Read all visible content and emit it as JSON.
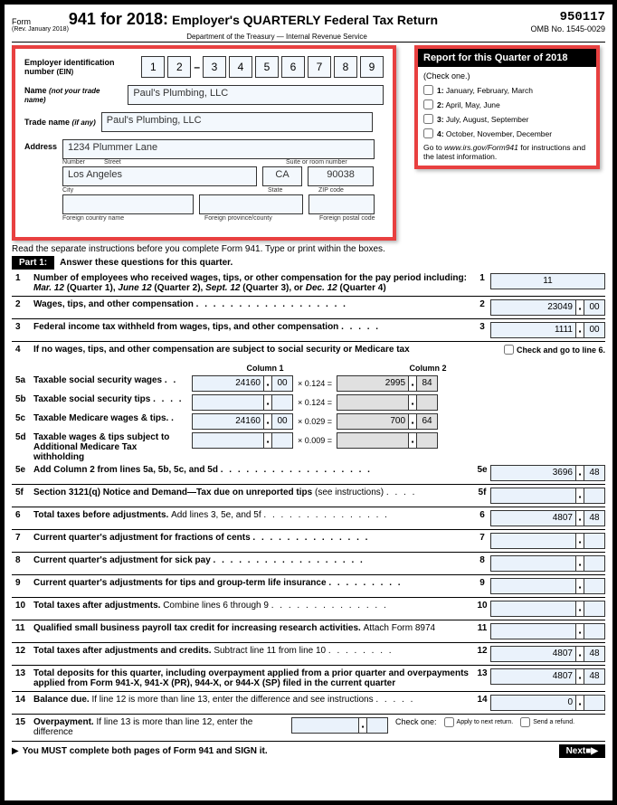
{
  "form": {
    "num_label": "Form",
    "title": "941 for 2018:",
    "subtitle": "Employer's QUARTERLY Federal Tax Return",
    "rev": "(Rev. January 2018)",
    "dept": "Department of the Treasury — Internal Revenue Service",
    "tracking": "950117",
    "omb": "OMB No. 1545-0029"
  },
  "emp": {
    "ein_label": "Employer identification number",
    "ein_paren": "(EIN)",
    "ein": [
      "1",
      "2",
      "3",
      "4",
      "5",
      "6",
      "7",
      "8",
      "9"
    ],
    "name_label": "Name",
    "name_paren": "(not your trade name)",
    "name": "Paul's Plumbing, LLC",
    "trade_label": "Trade name",
    "trade_paren": "(if any)",
    "trade": "Paul's Plumbing, LLC",
    "addr_label": "Address",
    "street": "1234 Plummer Lane",
    "number_l": "Number",
    "street_l": "Street",
    "suite_l": "Suite or room number",
    "city": "Los Angeles",
    "state": "CA",
    "zip": "90038",
    "city_l": "City",
    "state_l": "State",
    "zip_l": "ZIP code",
    "fc_l": "Foreign country name",
    "fp_l": "Foreign province/county",
    "fz_l": "Foreign postal code"
  },
  "quarter": {
    "header": "Report for this Quarter of 2018",
    "check": "(Check one.)",
    "q1": "1: January, February, March",
    "q2": "2: April, May, June",
    "q3": "3: July, August, September",
    "q4": "4: October, November, December",
    "note1": "Go to ",
    "url": "www.irs.gov/Form941",
    "note2": " for instructions and the latest information."
  },
  "instr": "Read the separate instructions before you complete Form 941. Type or print within the boxes.",
  "part1": {
    "label": "Part 1:",
    "text": "Answer these questions for this quarter."
  },
  "lines": {
    "l1": {
      "n": "1",
      "t": "Number of employees who received wages, tips, or other compensation for the pay period including: ",
      "t2": "Mar. 12",
      "t3": " (Quarter 1), ",
      "t4": "June 12",
      "t5": " (Quarter 2), ",
      "t6": "Sept. 12",
      "t7": " (Quarter 3), or ",
      "t8": "Dec. 12",
      "t9": " (Quarter 4)",
      "r": "1",
      "v": "11"
    },
    "l2": {
      "n": "2",
      "t": "Wages, tips, and other compensation",
      "r": "2",
      "v": "23049",
      "c": "00"
    },
    "l3": {
      "n": "3",
      "t": "Federal income tax withheld from wages, tips, and other compensation",
      "r": "3",
      "v": "1111",
      "c": "00"
    },
    "l4": {
      "n": "4",
      "t": "If no wages, tips, and other compensation are subject to social security or Medicare tax",
      "chk": "Check and go to line 6."
    },
    "col1": "Column 1",
    "col2": "Column 2",
    "l5a": {
      "n": "5a",
      "t": "Taxable social security wages",
      "v1": "24160",
      "c1": "00",
      "m": "× 0.124 =",
      "v2": "2995",
      "c2": "84"
    },
    "l5b": {
      "n": "5b",
      "t": "Taxable social security tips",
      "m": "× 0.124 ="
    },
    "l5c": {
      "n": "5c",
      "t": "Taxable Medicare wages & tips.",
      "v1": "24160",
      "c1": "00",
      "m": "× 0.029 =",
      "v2": "700",
      "c2": "64"
    },
    "l5d": {
      "n": "5d",
      "t": "Taxable wages & tips subject to Additional Medicare Tax withholding",
      "m": "× 0.009 ="
    },
    "l5e": {
      "n": "5e",
      "t": "Add Column 2 from lines 5a, 5b, 5c, and 5d",
      "r": "5e",
      "v": "3696",
      "c": "48"
    },
    "l5f": {
      "n": "5f",
      "t": "Section 3121(q) Notice and Demand—Tax due on unreported tips ",
      "t2": "(see instructions)",
      "r": "5f"
    },
    "l6": {
      "n": "6",
      "t": "Total taxes before adjustments. ",
      "t2": "Add lines 3, 5e, and 5f",
      "r": "6",
      "v": "4807",
      "c": "48"
    },
    "l7": {
      "n": "7",
      "t": "Current quarter's adjustment for fractions of cents",
      "r": "7"
    },
    "l8": {
      "n": "8",
      "t": "Current quarter's adjustment for sick pay",
      "r": "8"
    },
    "l9": {
      "n": "9",
      "t": "Current quarter's adjustments for tips and group-term life insurance",
      "r": "9"
    },
    "l10": {
      "n": "10",
      "t": "Total taxes after adjustments. ",
      "t2": "Combine lines 6 through 9",
      "r": "10"
    },
    "l11": {
      "n": "11",
      "t": "Qualified small business payroll tax credit for increasing research activities. ",
      "t2": "Attach Form 8974",
      "r": "11"
    },
    "l12": {
      "n": "12",
      "t": "Total taxes after adjustments and credits. ",
      "t2": "Subtract line 11 from line 10",
      "r": "12",
      "v": "4807",
      "c": "48"
    },
    "l13": {
      "n": "13",
      "t": "Total deposits for this quarter, including overpayment applied from a prior quarter and overpayments applied from Form 941-X, 941-X (PR), 944-X, or 944-X (SP) filed in the current quarter",
      "r": "13",
      "v": "4807",
      "c": "48"
    },
    "l14": {
      "n": "14",
      "t": "Balance due. ",
      "t2": "If line 12 is more than line 13, enter the difference and see instructions",
      "r": "14",
      "v": "0"
    },
    "l15": {
      "n": "15",
      "t": "Overpayment. ",
      "t2": "If line 13 is more than line 12, enter the difference",
      "chk": "Check one:",
      "opt1": "Apply to next return.",
      "opt2": "Send a refund."
    }
  },
  "footer": {
    "must": "You MUST complete both pages of Form 941 and SIGN it.",
    "next": "Next ■▶"
  }
}
